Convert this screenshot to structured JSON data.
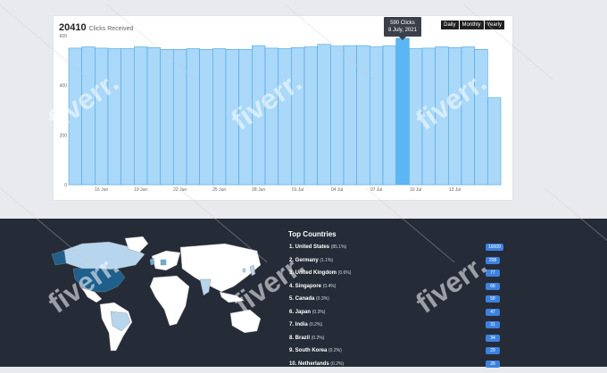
{
  "header": {
    "total": "20410",
    "total_label": "Clicks Received",
    "ranges": [
      "Daily",
      "Monthly",
      "Yearly"
    ]
  },
  "tooltip": {
    "line1": "590 Clicks",
    "line2": "8 July, 2021"
  },
  "chart_data": {
    "type": "bar",
    "ylim": [
      0,
      600
    ],
    "yticks": [
      "0",
      "200",
      "400",
      "600"
    ],
    "xtick_labels": [
      "16 Jun",
      "19 Jun",
      "22 Jun",
      "25 Jun",
      "28 Jun",
      "01 Jul",
      "04 Jul",
      "07 Jul",
      "10 Jul",
      "13 Jul"
    ],
    "highlight_index": 25,
    "values": [
      550,
      555,
      550,
      548,
      548,
      555,
      552,
      545,
      545,
      548,
      545,
      548,
      545,
      545,
      560,
      550,
      548,
      552,
      555,
      565,
      558,
      560,
      560,
      555,
      560,
      590,
      548,
      550,
      555,
      552,
      555,
      545,
      350
    ],
    "bar_color": "#a9d8f9",
    "bar_stroke": "#4aa6e3",
    "highlight_color": "#5bb6f5"
  },
  "countries": {
    "title": "Top Countries",
    "items": [
      {
        "label": "1. United States",
        "pct": "(85.1%)",
        "count": "16009"
      },
      {
        "label": "2. Germany",
        "pct": "(1.1%)",
        "count": "208"
      },
      {
        "label": "3. United Kingdom",
        "pct": "(0.6%)",
        "count": "77"
      },
      {
        "label": "4. Singapore",
        "pct": "(0.4%)",
        "count": "66"
      },
      {
        "label": "5. Canada",
        "pct": "(0.3%)",
        "count": "58"
      },
      {
        "label": "6. Japan",
        "pct": "(0.3%)",
        "count": "47"
      },
      {
        "label": "7. India",
        "pct": "(0.2%)",
        "count": "31"
      },
      {
        "label": "8. Brazil",
        "pct": "(0.2%)",
        "count": "34"
      },
      {
        "label": "9. South Korea",
        "pct": "(0.2%)",
        "count": "29"
      },
      {
        "label": "10. Netherlands",
        "pct": "(0.2%)",
        "count": "26"
      }
    ]
  },
  "watermark": "fiverr.",
  "colors": {
    "map_top": "#1e5f8c",
    "map_mid": "#6aaed6",
    "map_low": "#b7d6ee",
    "map_base": "#ffffff"
  }
}
